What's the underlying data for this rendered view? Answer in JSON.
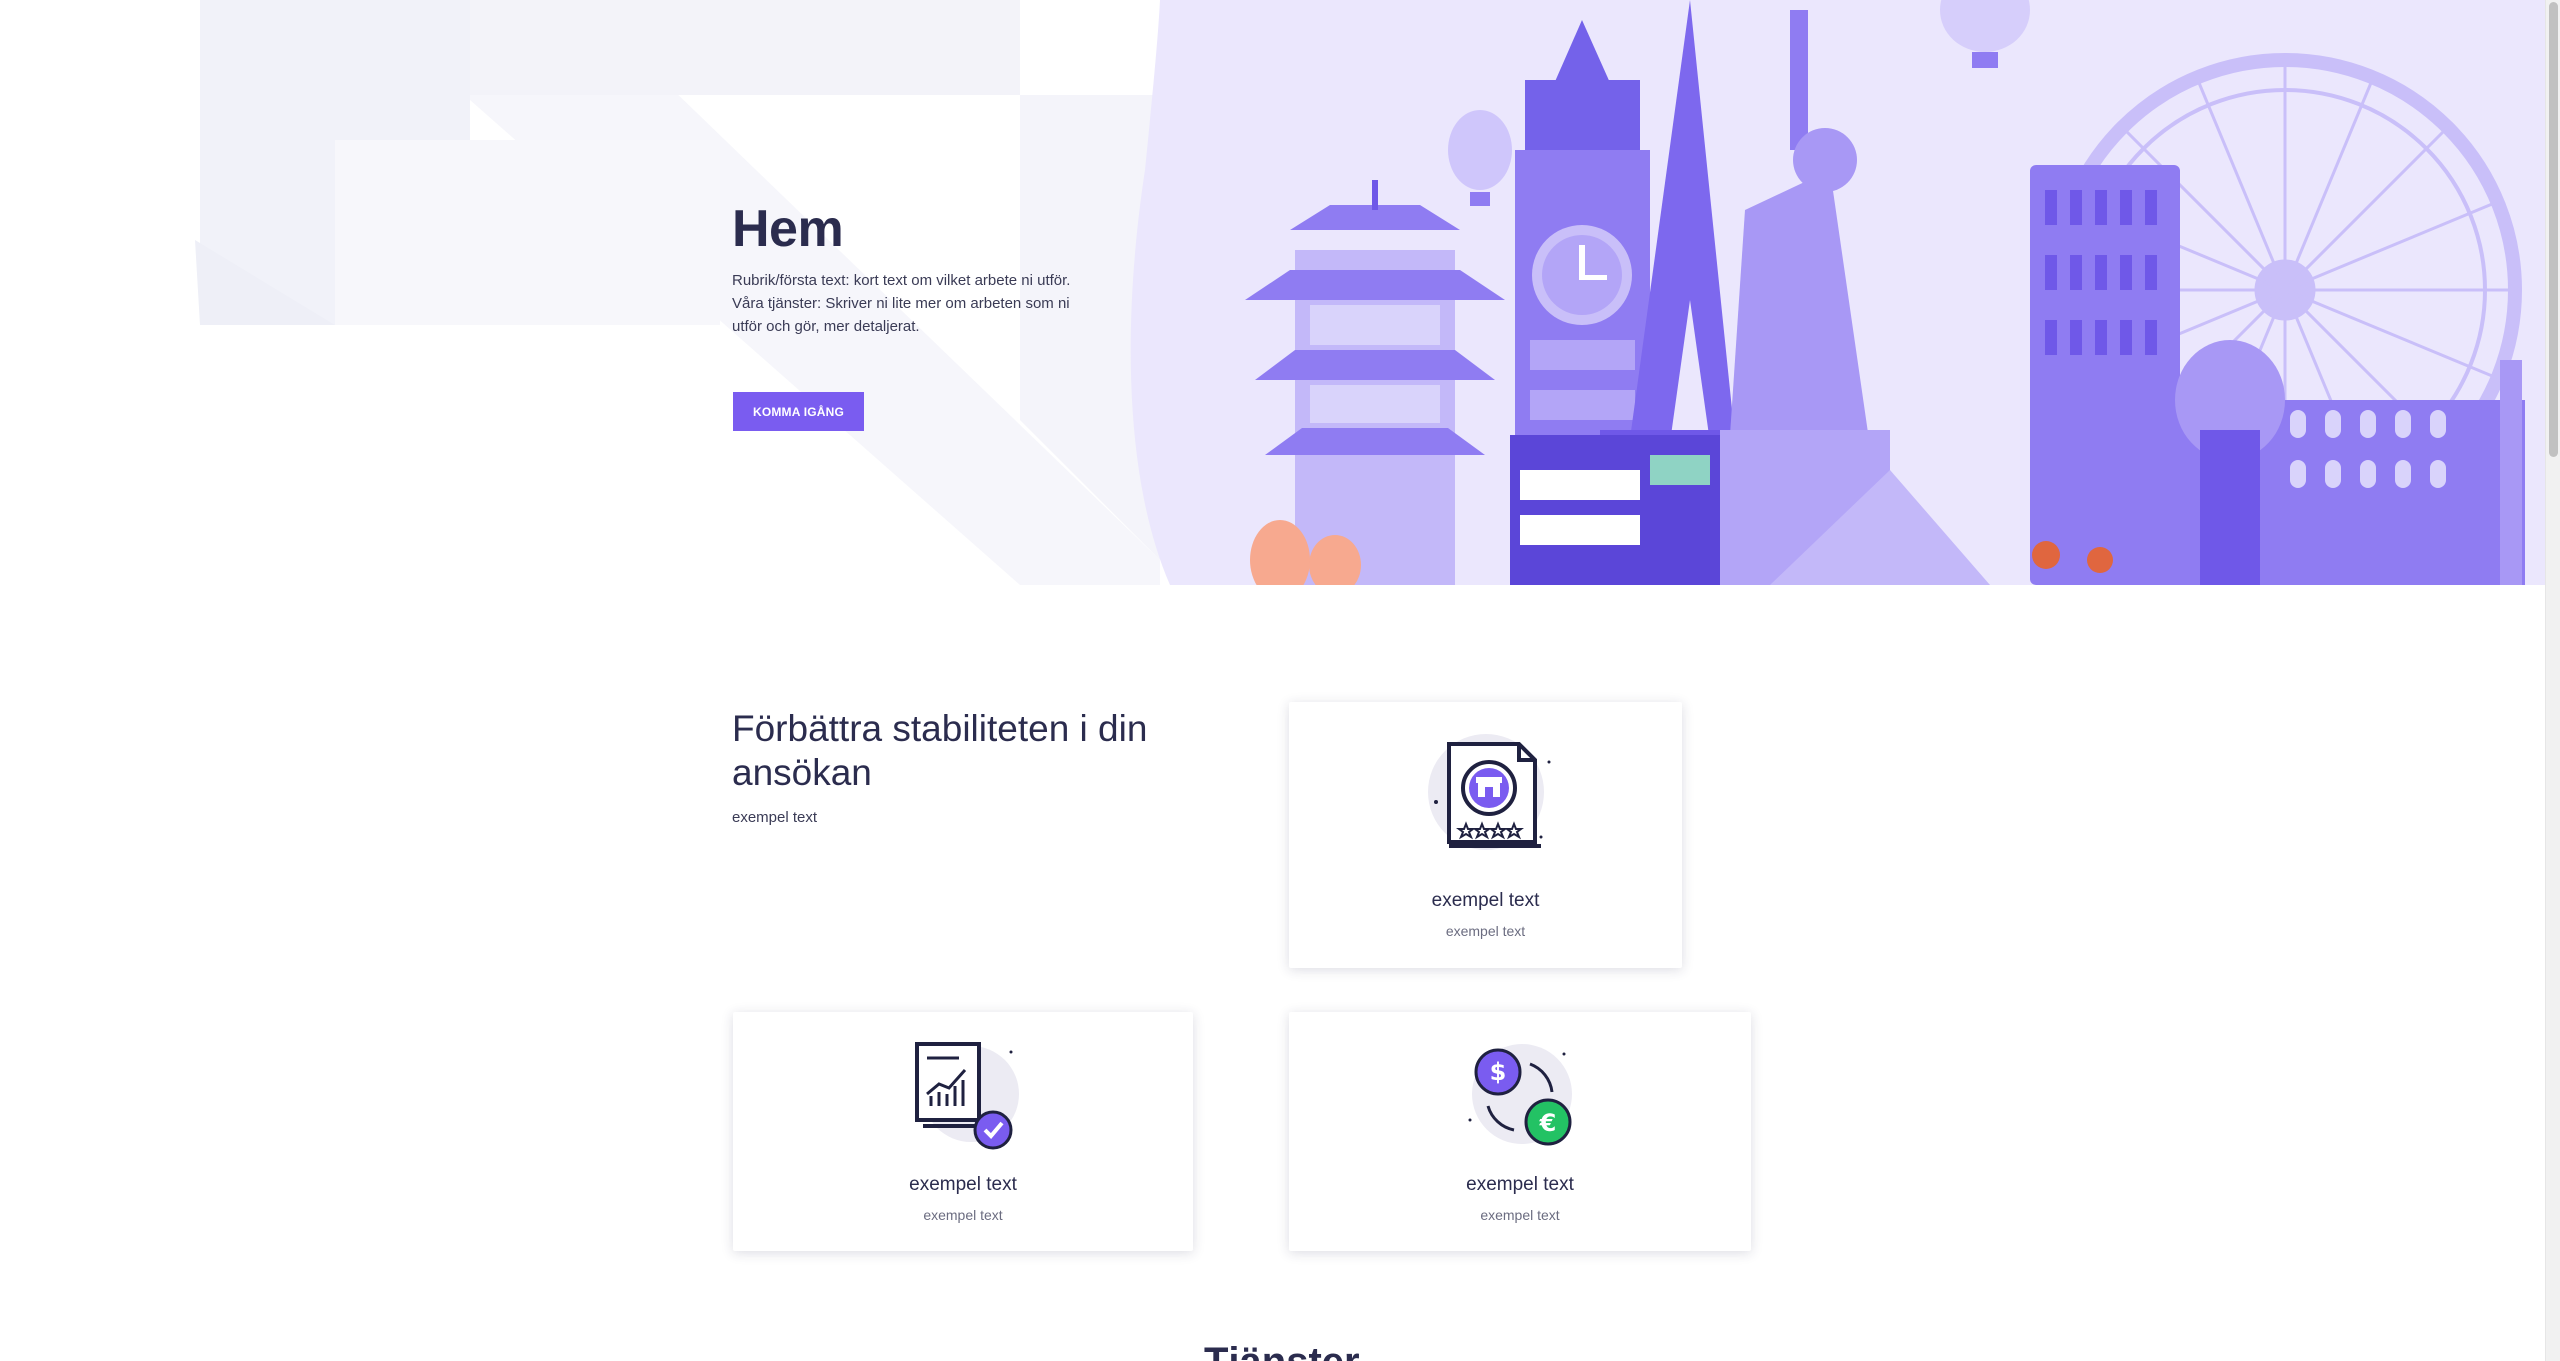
{
  "hero": {
    "title": "Hem",
    "text": "Rubrik/första text: kort text om vilket arbete ni utför. Våra tjänster: Skriver ni lite mer om arbeten som ni utför och gör, mer detaljerat.",
    "button_label": "KOMMA IGÅNG"
  },
  "features": {
    "heading": "Förbättra stabiliteten i din ansökan",
    "subtext": "exempel text",
    "cards": [
      {
        "icon": "store-document-icon",
        "title": "exempel text",
        "subtitle": "exempel text"
      },
      {
        "icon": "report-check-icon",
        "title": "exempel text",
        "subtitle": "exempel text"
      },
      {
        "icon": "currency-exchange-icon",
        "title": "exempel text",
        "subtitle": "exempel text"
      }
    ]
  },
  "next_section": {
    "heading": "Tjänster"
  },
  "colors": {
    "accent": "#7a5cf0",
    "heading": "#2b2c4e",
    "illustration_light": "#d9d3fb",
    "illustration_mid": "#a898f5",
    "illustration_dark": "#6f58e8",
    "euro_green": "#23c264"
  }
}
